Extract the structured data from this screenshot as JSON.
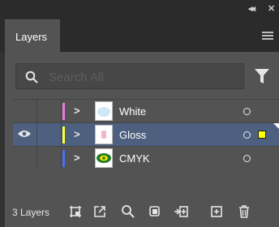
{
  "window": {
    "collapse_icon": "double-chevron-icon",
    "close_icon": "close-icon"
  },
  "panel": {
    "tab_label": "Layers",
    "menu_icon": "hamburger-menu-icon"
  },
  "search": {
    "placeholder": "Search All",
    "value": "",
    "icon": "search-icon"
  },
  "filter_icon": "filter-icon",
  "layers": [
    {
      "name": "White",
      "color": "#e87ad9",
      "visible": false,
      "selected": false,
      "expand_icon": "chevron-right-icon",
      "thumbnail": "white-thumbnail"
    },
    {
      "name": "Gloss",
      "color": "#ffff33",
      "visible": true,
      "selected": true,
      "expand_icon": "chevron-right-icon",
      "thumbnail": "gloss-thumbnail",
      "selection_color": "#ffff00"
    },
    {
      "name": "CMYK",
      "color": "#4a6ff0",
      "visible": false,
      "selected": false,
      "expand_icon": "chevron-right-icon",
      "thumbnail": "cmyk-thumbnail"
    }
  ],
  "footer": {
    "layer_count": "3 Layers",
    "icons": [
      "artboard-icon",
      "export-icon",
      "locate-object-icon",
      "clipping-mask-icon",
      "new-sublayer-icon",
      "new-layer-icon",
      "delete-icon"
    ]
  }
}
